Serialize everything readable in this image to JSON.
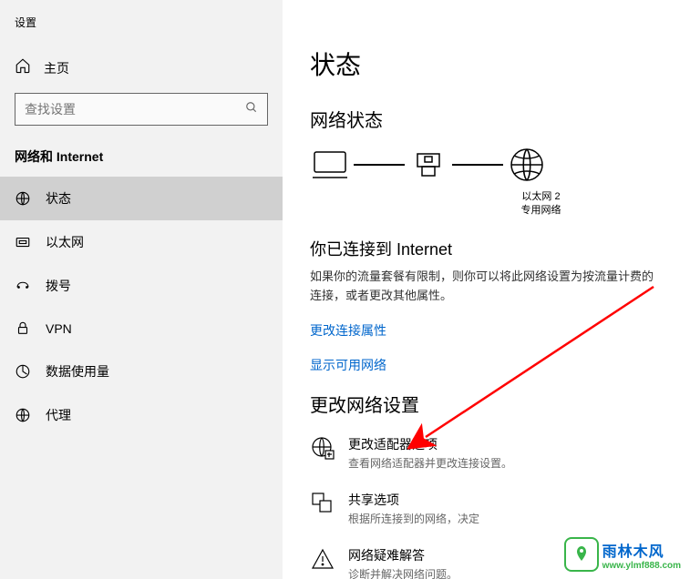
{
  "app_title": "设置",
  "home_label": "主页",
  "search": {
    "placeholder": "查找设置"
  },
  "section_header": "网络和 Internet",
  "nav": [
    {
      "label": "状态",
      "icon": "status"
    },
    {
      "label": "以太网",
      "icon": "ethernet"
    },
    {
      "label": "拨号",
      "icon": "dialup"
    },
    {
      "label": "VPN",
      "icon": "vpn"
    },
    {
      "label": "数据使用量",
      "icon": "data"
    },
    {
      "label": "代理",
      "icon": "proxy"
    }
  ],
  "page_title": "状态",
  "network_status_title": "网络状态",
  "diagram": {
    "eth_name": "以太网 2",
    "eth_type": "专用网络"
  },
  "connected": {
    "title": "你已连接到 Internet",
    "desc": "如果你的流量套餐有限制，则你可以将此网络设置为按流量计费的连接，或者更改其他属性。"
  },
  "link_props": "更改连接属性",
  "link_show": "显示可用网络",
  "change_title": "更改网络设置",
  "options": [
    {
      "title": "更改适配器选项",
      "desc": "查看网络适配器并更改连接设置。",
      "icon": "globe"
    },
    {
      "title": "共享选项",
      "desc": "根据所连接到的网络，决定",
      "icon": "share"
    },
    {
      "title": "网络疑难解答",
      "desc": "诊断并解决网络问题。",
      "icon": "troubleshoot"
    }
  ],
  "watermark": {
    "cn": "雨林木风",
    "url": "www.ylmf888.com"
  }
}
